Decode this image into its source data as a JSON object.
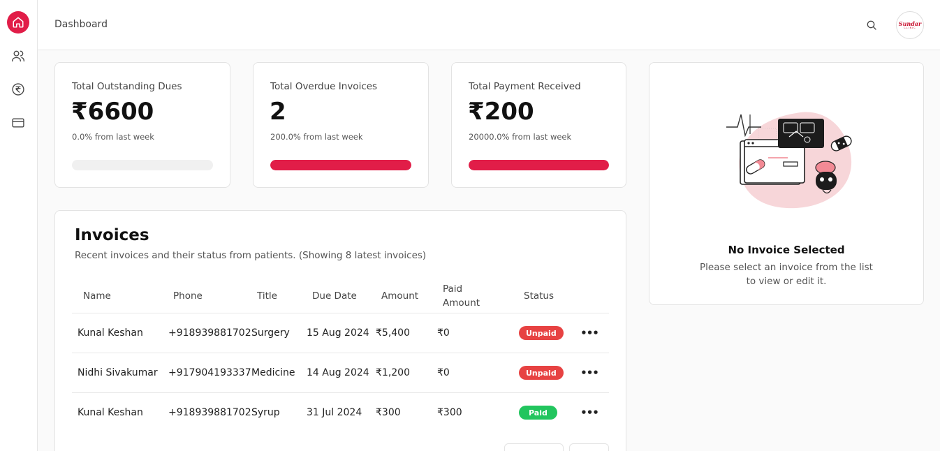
{
  "colors": {
    "accent": "#e11d48",
    "unpaid": "#e74242",
    "paid": "#22c55e"
  },
  "sidebar": {
    "items": [
      {
        "icon": "home-icon",
        "active": true
      },
      {
        "icon": "users-icon",
        "active": false
      },
      {
        "icon": "rupee-icon",
        "active": false
      },
      {
        "icon": "credit-card-icon",
        "active": false
      }
    ]
  },
  "header": {
    "title": "Dashboard",
    "search_icon": "search-icon",
    "avatar": {
      "line1": "Sundar",
      "line2": "CLINIC"
    }
  },
  "stats": [
    {
      "label": "Total Outstanding Dues",
      "value": "₹6600",
      "change": "0.0% from last week",
      "progress": 0.0
    },
    {
      "label": "Total Overdue Invoices",
      "value": "2",
      "change": "200.0% from last week",
      "progress": 1.0
    },
    {
      "label": "Total Payment Received",
      "value": "₹200",
      "change": "20000.0% from last week",
      "progress": 1.0
    }
  ],
  "invoices": {
    "title": "Invoices",
    "subtitle": "Recent invoices and their status from patients. (Showing 8 latest invoices)",
    "columns": {
      "name": "Name",
      "phone": "Phone",
      "title": "Title",
      "due": "Due Date",
      "amount": "Amount",
      "paid": "Paid Amount",
      "status": "Status"
    },
    "rows": [
      {
        "name": "Kunal Keshan",
        "phone": "+918939881702",
        "title": "Surgery",
        "due": "15 Aug 2024",
        "amount": "₹5,400",
        "paid": "₹0",
        "status": "Unpaid"
      },
      {
        "name": "Nidhi Sivakumar",
        "phone": "+917904193337",
        "title": "Medicine",
        "due": "14 Aug 2024",
        "amount": "₹1,200",
        "paid": "₹0",
        "status": "Unpaid"
      },
      {
        "name": "Kunal Keshan",
        "phone": "+918939881702",
        "title": "Syrup",
        "due": "31 Jul 2024",
        "amount": "₹300",
        "paid": "₹300",
        "status": "Paid"
      }
    ],
    "row_menu_icon": "more-horizontal-icon"
  },
  "detail": {
    "title": "No Invoice Selected",
    "message": "Please select an invoice from the list to view or edit it."
  }
}
